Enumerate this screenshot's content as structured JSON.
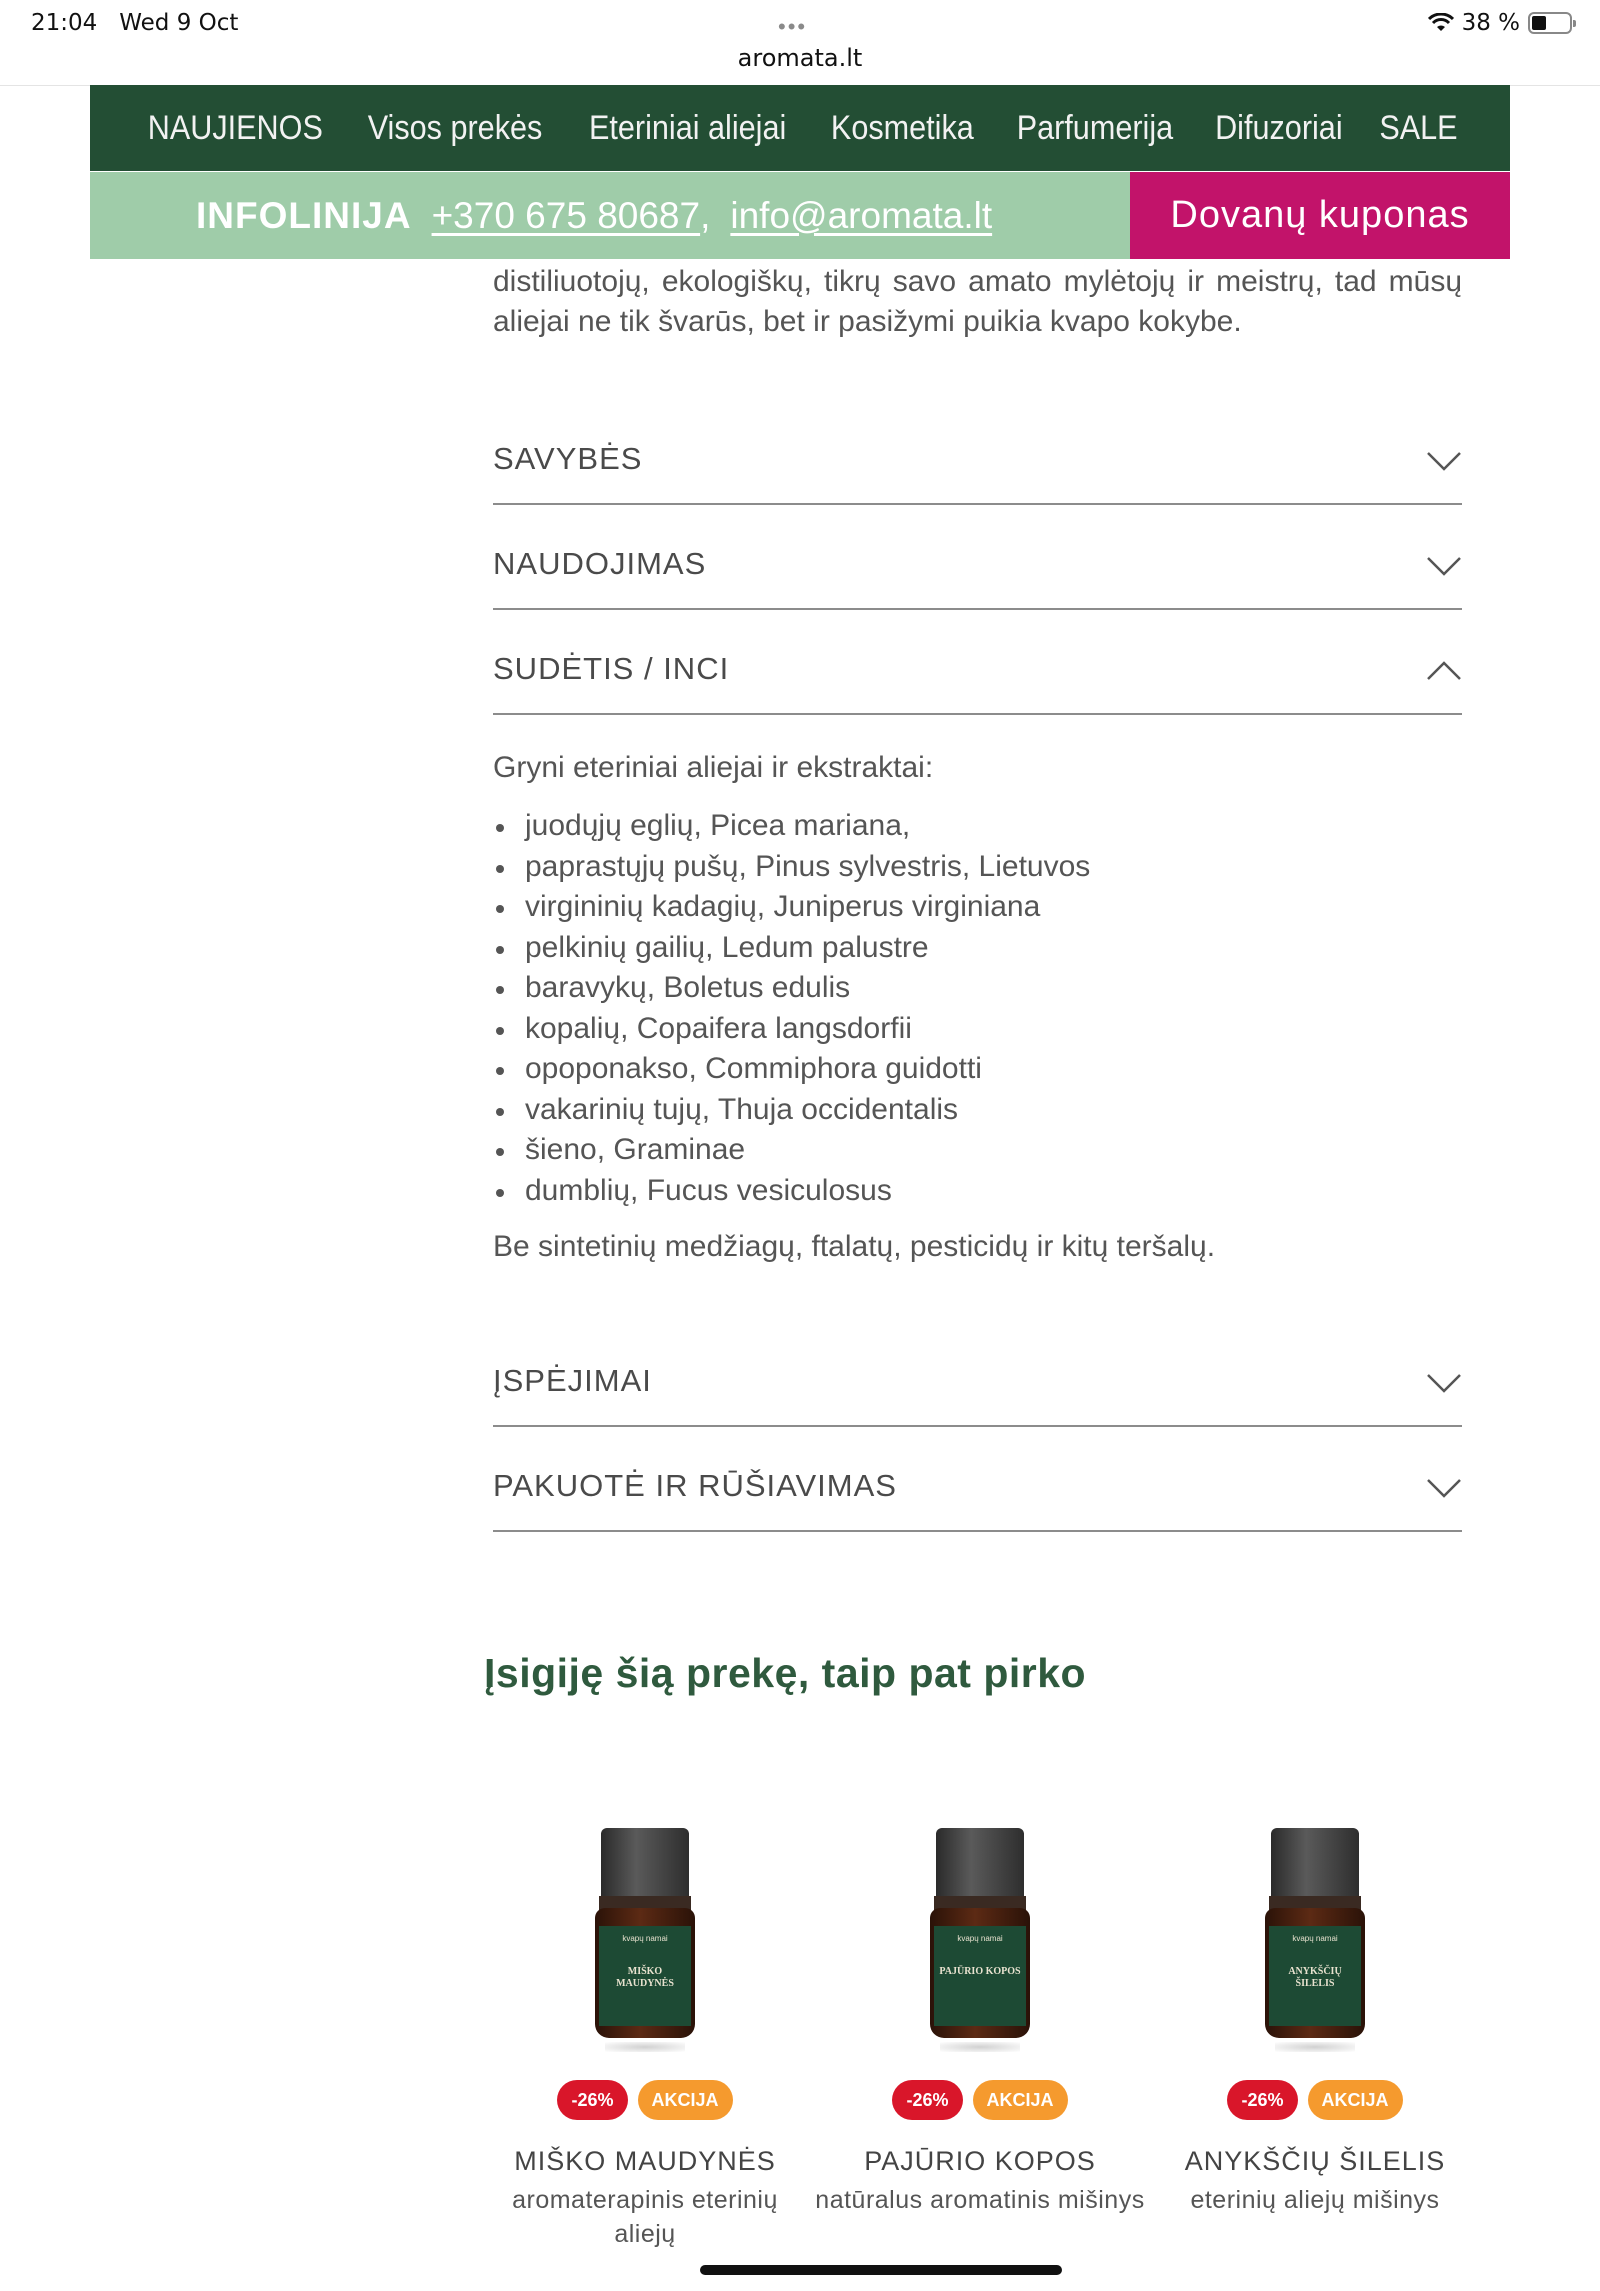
{
  "status_bar": {
    "time": "21:04",
    "date": "Wed 9 Oct",
    "battery": "38 %",
    "battery_level": 0.38,
    "url": "aromata.lt",
    "menu_dots": "•••"
  },
  "nav": {
    "items": [
      "NAUJIENOS",
      "Visos prekės",
      "Eteriniai aliejai",
      "Kosmetika",
      "Parfumerija",
      "Difuzoriai",
      "SALE"
    ],
    "background": "#234e34"
  },
  "infobar": {
    "label": "INFOLINIJA",
    "phone": "+370 675 80687",
    "separator": ",",
    "email": "info@aromata.lt",
    "coupon": "Dovanų kuponas",
    "background": "#9fcca9",
    "coupon_background": "#c2136a"
  },
  "intro_text": "distiliuotojų, ekologiškų, tikrų savo amato mylėtojų ir meistrų, tad mūsų aliejai ne tik švarūs, bet ir pasižymi puikia kvapo kokybe.",
  "accordions": [
    {
      "title": "SAVYBĖS",
      "open": false
    },
    {
      "title": "NAUDOJIMAS",
      "open": false
    },
    {
      "title": "SUDĖTIS / INCI",
      "open": true
    },
    {
      "title": "ĮSPĖJIMAI",
      "open": false
    },
    {
      "title": "PAKUOTĖ IR RŪŠIAVIMAS",
      "open": false
    }
  ],
  "inci": {
    "lead": "Gryni eteriniai aliejai ir ekstraktai:",
    "items": [
      "juodųjų eglių, Picea mariana,",
      "paprastųjų pušų, Pinus sylvestris, Lietuvos",
      "virgininių kadagių, Juniperus virginiana",
      "pelkinių gailių, Ledum palustre",
      "baravykų, Boletus edulis",
      "kopalių, Copaifera langsdorfii",
      "opoponakso, Commiphora guidotti",
      "vakarinių tujų, Thuja occidentalis",
      "šieno, Graminae",
      "dumblių, Fucus vesiculosus"
    ],
    "foot": "Be sintetinių medžiagų, ftalatų, pesticidų ir kitų teršalų."
  },
  "related": {
    "title": "Įsigiję šią prekę, taip pat pirko",
    "products": [
      {
        "name": "MIŠKO MAUDYNĖS",
        "desc": "aromaterapinis eterinių aliejų",
        "label_text": "MIŠKO MAUDYNĖS",
        "brand": "kvapų namai",
        "discount": "-26%",
        "sale": "AKCIJA"
      },
      {
        "name": "PAJŪRIO KOPOS",
        "desc": "natūralus aromatinis mišinys",
        "label_text": "PAJŪRIO KOPOS",
        "brand": "kvapų namai",
        "discount": "-26%",
        "sale": "AKCIJA"
      },
      {
        "name": "ANYKŠČIŲ ŠILELIS",
        "desc": "eterinių aliejų mišinys",
        "label_text": "ANYKŠČIŲ ŠILELIS",
        "brand": "kvapų namai",
        "discount": "-26%",
        "sale": "AKCIJA"
      }
    ]
  }
}
